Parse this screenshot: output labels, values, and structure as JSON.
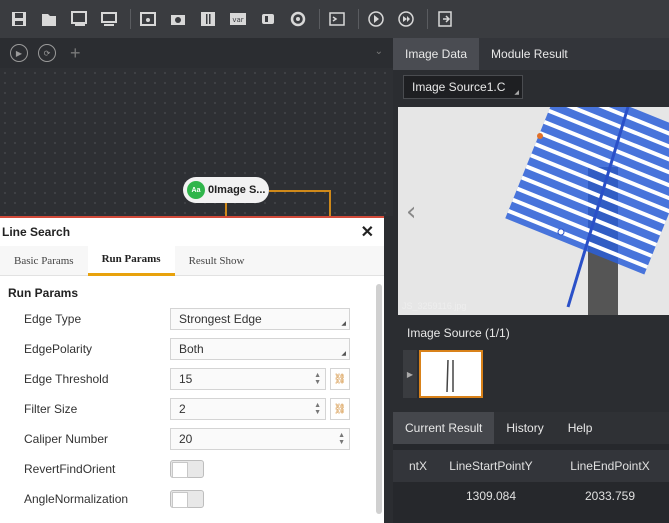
{
  "toolbar": {
    "icons": [
      "save-icon",
      "open-folder-icon",
      "import-icon",
      "monitor-icon",
      "image-icon",
      "camera-icon",
      "film-icon",
      "var-icon",
      "device-icon",
      "settings-icon",
      "terminal-icon",
      "run-once-icon",
      "run-loop-icon",
      "export-icon"
    ],
    "var_label": "var"
  },
  "canvas": {
    "node_label": "0Image S...",
    "node_icon_text": "Aa"
  },
  "dialog": {
    "title": "Line Search",
    "close": "✕",
    "tabs": [
      "Basic Params",
      "Run Params",
      "Result Show"
    ],
    "active_tab": "Run Params",
    "section": "Run Params",
    "rows": [
      {
        "label": "Edge Type",
        "value": "Strongest Edge",
        "kind": "select"
      },
      {
        "label": "EdgePolarity",
        "value": "Both",
        "kind": "select"
      },
      {
        "label": "Edge Threshold",
        "value": "15",
        "kind": "number-link"
      },
      {
        "label": "Filter Size",
        "value": "2",
        "kind": "number-link"
      },
      {
        "label": "Caliper Number",
        "value": "20",
        "kind": "number"
      },
      {
        "label": "RevertFindOrient",
        "value": false,
        "kind": "toggle"
      },
      {
        "label": "AngleNormalization",
        "value": false,
        "kind": "toggle"
      }
    ]
  },
  "right": {
    "tabs": [
      "Image Data",
      "Module Result"
    ],
    "active_tab": "Image Data",
    "source_select": "Image Source1.C",
    "image_caption": "JS_3259116.jpg",
    "image_source_title": "Image Source (1/1)",
    "result_tabs": [
      "Current Result",
      "History",
      "Help"
    ],
    "active_result_tab": "Current Result",
    "table": {
      "headers": [
        "ntX",
        "LineStartPointY",
        "LineEndPointX"
      ],
      "rows": [
        [
          "",
          "1309.084",
          "2033.759"
        ]
      ]
    }
  },
  "colors": {
    "accent_orange": "#e8a20c",
    "dialog_border": "#d24a3a",
    "node_green": "#2fb54a"
  }
}
